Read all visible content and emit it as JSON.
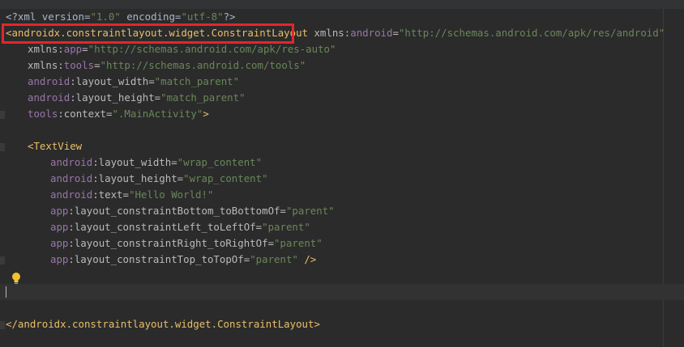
{
  "editor": {
    "lines": [
      {
        "id": "l1",
        "parts": [
          "<?",
          "xml version=",
          "\"1.0\"",
          " encoding=",
          "\"utf-8\"",
          "?>"
        ]
      },
      {
        "id": "l2",
        "parts": [
          "<androidx.constraintlayout.widget.ConstraintLayout",
          " ",
          "xmlns:",
          "android",
          "=",
          "\"http://schemas.android.com/apk/res/android\""
        ]
      },
      {
        "id": "l3",
        "parts": [
          "xmlns:",
          "app",
          "=",
          "\"http://schemas.android.com/apk/res-auto\""
        ]
      },
      {
        "id": "l4",
        "parts": [
          "xmlns:",
          "tools",
          "=",
          "\"http://schemas.android.com/tools\""
        ]
      },
      {
        "id": "l5",
        "parts": [
          "android",
          ":layout_width=",
          "\"match_parent\""
        ]
      },
      {
        "id": "l6",
        "parts": [
          "android",
          ":layout_height=",
          "\"match_parent\""
        ]
      },
      {
        "id": "l7",
        "parts": [
          "tools",
          ":context=",
          "\".MainActivity\"",
          ">"
        ]
      },
      {
        "id": "l8",
        "parts": [
          "<TextView"
        ]
      },
      {
        "id": "l9",
        "parts": [
          "android",
          ":layout_width=",
          "\"wrap_content\""
        ]
      },
      {
        "id": "l10",
        "parts": [
          "android",
          ":layout_height=",
          "\"wrap_content\""
        ]
      },
      {
        "id": "l11",
        "parts": [
          "android",
          ":text=",
          "\"Hello World!\""
        ]
      },
      {
        "id": "l12",
        "parts": [
          "app",
          ":layout_constraintBottom_toBottomOf=",
          "\"parent\""
        ]
      },
      {
        "id": "l13",
        "parts": [
          "app",
          ":layout_constraintLeft_toLeftOf=",
          "\"parent\""
        ]
      },
      {
        "id": "l14",
        "parts": [
          "app",
          ":layout_constraintRight_toRightOf=",
          "\"parent\""
        ]
      },
      {
        "id": "l15",
        "parts": [
          "app",
          ":layout_constraintTop_toTopOf=",
          "\"parent\"",
          " />"
        ]
      },
      {
        "id": "l16",
        "parts": [
          "</androidx.constraintlayout.widget.ConstraintLayout>"
        ]
      }
    ]
  },
  "colors": {
    "background": "#2b2b2b",
    "tag": "#e8bf6a",
    "namespace": "#9876aa",
    "attribute": "#bababa",
    "string_value": "#6a8759",
    "highlight_box": "#e3262b"
  },
  "icons": {
    "intention_bulb": "lightbulb-icon"
  }
}
